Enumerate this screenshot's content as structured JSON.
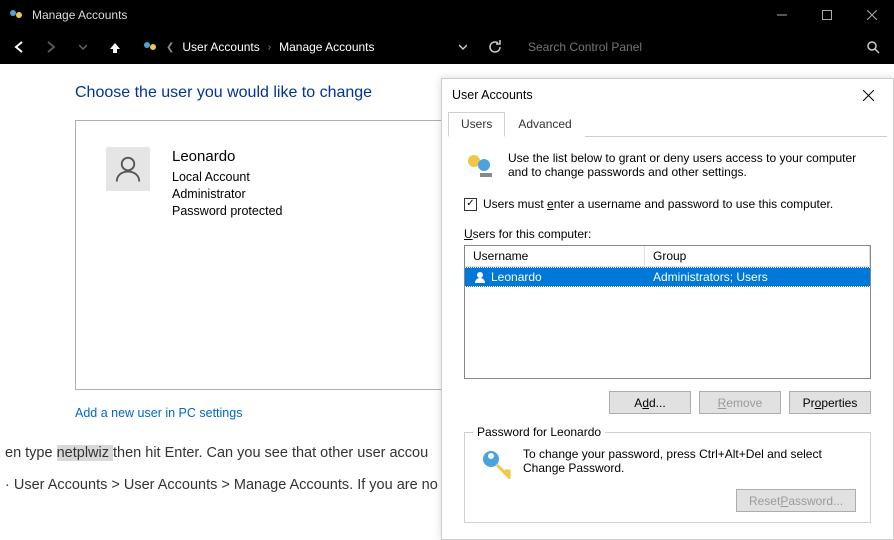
{
  "titlebar": {
    "title": "Manage Accounts"
  },
  "breadcrumb": {
    "level1": "User Accounts",
    "level2": "Manage Accounts"
  },
  "search": {
    "placeholder": "Search Control Panel"
  },
  "heading": "Choose the user you would like to change",
  "user": {
    "name": "Leonardo",
    "type": "Local Account",
    "role": "Administrator",
    "pw": "Password protected"
  },
  "link_add": "Add a new user in PC settings",
  "bg_text": {
    "line1a": "en type ",
    "line1b": "netplwiz ",
    "line1c": "then hit Enter. Can you see that other user accou",
    "line2": "· User Accounts > User Accounts > Manage Accounts. If you are no"
  },
  "dialog": {
    "title": "User Accounts",
    "tabs": {
      "users": "Users",
      "advanced": "Advanced"
    },
    "blurb": "Use the list below to grant or deny users access to your computer and to change passwords and other settings.",
    "checkbox_label": "Users must enter a username and password to use this computer.",
    "list_label": "Users for this computer:",
    "columns": {
      "c1": "Username",
      "c2": "Group"
    },
    "row": {
      "name": "Leonardo",
      "group": "Administrators; Users"
    },
    "buttons": {
      "add": "Add...",
      "remove": "Remove",
      "props": "Properties"
    },
    "fieldset_legend": "Password for Leonardo",
    "fieldset_body": "To change your password, press Ctrl+Alt+Del and select Change Password.",
    "reset": "Reset Password..."
  }
}
